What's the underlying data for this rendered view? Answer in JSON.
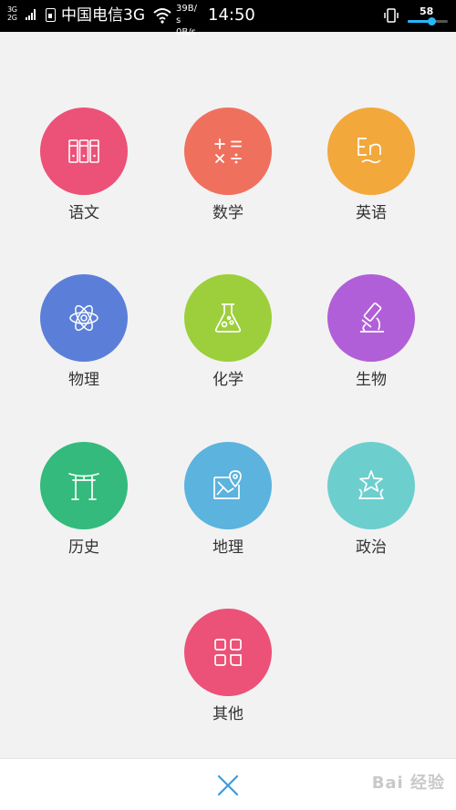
{
  "status_bar": {
    "network_type_top": "3G",
    "network_type_bottom": "2G",
    "carrier": "中国电信3G",
    "speed_line1": "39B/",
    "speed_line2": "s",
    "speed_line3": "0B/s",
    "time": "14:50",
    "battery_level": 58,
    "battery_label": "58"
  },
  "subjects": [
    {
      "label": "语文",
      "icon": "books-icon",
      "color": "#ec5177"
    },
    {
      "label": "数学",
      "icon": "math-operators-icon",
      "color": "#f0705e"
    },
    {
      "label": "英语",
      "icon": "english-en-icon",
      "color": "#f2a83b"
    },
    {
      "label": "物理",
      "icon": "atom-icon",
      "color": "#5b7fd9"
    },
    {
      "label": "化学",
      "icon": "flask-icon",
      "color": "#9ccf3b"
    },
    {
      "label": "生物",
      "icon": "microscope-icon",
      "color": "#b15fd8"
    },
    {
      "label": "历史",
      "icon": "gate-arch-icon",
      "color": "#33ba7c"
    },
    {
      "label": "地理",
      "icon": "map-pin-icon",
      "color": "#5bb3de"
    },
    {
      "label": "政治",
      "icon": "star-podium-icon",
      "color": "#6ccfce"
    },
    {
      "label": "其他",
      "icon": "grid-apps-icon",
      "color": "#ec5177"
    }
  ],
  "bottom_bar": {
    "close_icon": "close-icon",
    "watermark": "Bai 经验"
  }
}
